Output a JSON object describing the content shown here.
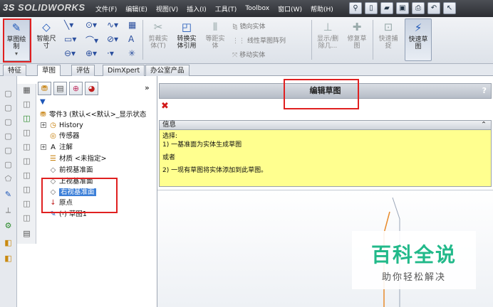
{
  "app": {
    "logo_prefix": "3S",
    "logo_name": "SOLIDWORKS"
  },
  "menu": [
    "文件(F)",
    "编辑(E)",
    "视图(V)",
    "插入(I)",
    "工具(T)",
    "Toolbox",
    "窗口(W)",
    "帮助(H)"
  ],
  "ribbon": {
    "sketch_edit": "草图绘\n制",
    "smart_dim": "智能尺\n寸",
    "cut_entities": "剪裁实\n体(T)",
    "convert_entities": "转换实\n体引用",
    "offset_entities": "等距实\n体",
    "mirror_entities": "镜向实体",
    "linear_pattern": "线性草图阵列",
    "move_entities": "移动实体",
    "display_delete": "显示/删\n除几...",
    "repair_sketch": "修复草\n图",
    "quick_snap": "快速捕\n捉",
    "rapid_sketch": "快速草\n图"
  },
  "tabs": [
    "特征",
    "草图",
    "评估",
    "DimXpert",
    "办公室产品"
  ],
  "tree": {
    "part": "零件3 (默认<<默认>_显示状态",
    "history": "History",
    "sensors": "传感器",
    "annotations": "注解",
    "material": "材质 <未指定>",
    "front_plane": "前视基准面",
    "top_plane": "上视基准面",
    "right_plane": "右视基准面",
    "origin": "原点",
    "sketch": "(-) 草图1"
  },
  "pm": {
    "title": "编辑草图",
    "help": "?",
    "info_title": "信息",
    "lines": [
      "选择:",
      "1) 一基准面为实体生成草图",
      "",
      "或者",
      "",
      "2) 一现有草图将实体添加到此草图。"
    ]
  },
  "watermark": {
    "title": "百科全说",
    "subtitle": "助你轻松解决"
  },
  "colors": {
    "accent": "#1e57b8",
    "highlight": "#e02020",
    "info_bg": "#ffff8f",
    "watermark": "#22b98a"
  }
}
